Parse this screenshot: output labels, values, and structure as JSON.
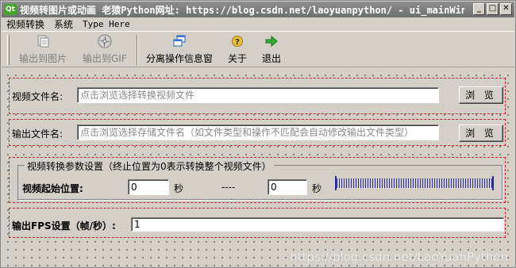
{
  "window": {
    "title": "视频转图片或动画   老猿Python网址: https://blog.csdn.net/laoyuanpython/ - ui_mainWin—",
    "logo_text": "Qt",
    "minimize_glyph": "_",
    "maximize_glyph": "□",
    "close_glyph": "✕"
  },
  "menubar": {
    "items": [
      "视频转换",
      "系统",
      "Type Here"
    ]
  },
  "toolbar": {
    "items": [
      {
        "label": "输出到图片",
        "icon": "image-output-icon",
        "enabled": false
      },
      {
        "label": "输出到GIF",
        "icon": "gif-output-icon",
        "enabled": false
      },
      {
        "label": "分离操作信息窗",
        "icon": "windows-icon",
        "enabled": true
      },
      {
        "label": "关于",
        "icon": "help-icon",
        "enabled": true
      },
      {
        "label": "退出",
        "icon": "exit-arrow-icon",
        "enabled": true
      }
    ]
  },
  "video_file": {
    "label": "视频文件名:",
    "placeholder": "点击浏览选择转换视频文件",
    "browse_label": "浏 览"
  },
  "output_file": {
    "label": "输出文件名:",
    "placeholder": "点击浏览选择存储文件名（如文件类型和操作不匹配会自动修改输出文件类型）",
    "browse_label": "浏 览"
  },
  "params": {
    "legend": "视频转换参数设置（终止位置为0表示转换整个视频文件）",
    "start_label": "视频起始位置:",
    "start_value": "0",
    "start_unit": "秒",
    "separator": "----",
    "end_value": "0",
    "end_unit": "秒"
  },
  "fps": {
    "label": "输出FPS设置（帧/秒）:",
    "value": "1"
  },
  "watermark": "https://blog.csdn.net/LaoYuanPython",
  "colors": {
    "titlebar": "#7f7f7f",
    "group_border": "#d01f2f",
    "slider": "#2a2aa8"
  }
}
